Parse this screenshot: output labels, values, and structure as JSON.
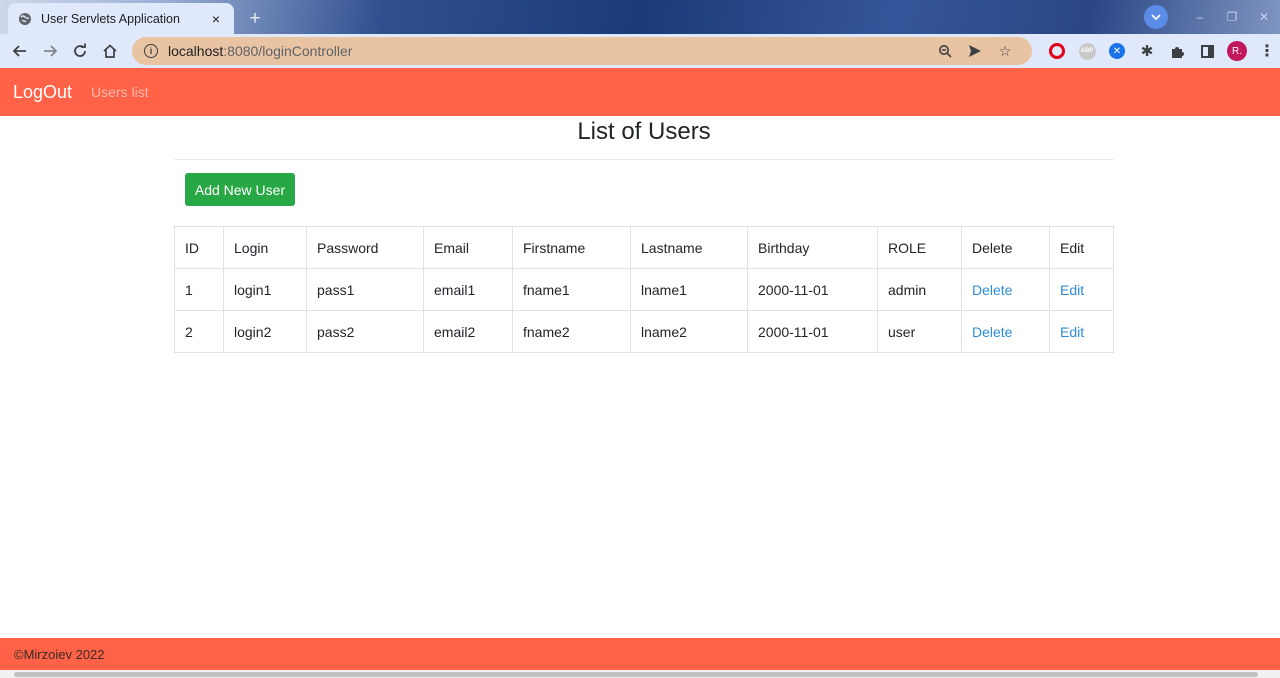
{
  "browser": {
    "tab_title": "User Servlets Application",
    "tab_close": "×",
    "new_tab": "+",
    "url_host": "localhost",
    "url_rest": ":8080/loginController",
    "avatar_initial": "R."
  },
  "navbar": {
    "brand": "LogOut",
    "link": "Users list"
  },
  "page": {
    "title": "List of Users",
    "add_button": "Add New User"
  },
  "table": {
    "headers": [
      "ID",
      "Login",
      "Password",
      "Email",
      "Firstname",
      "Lastname",
      "Birthday",
      "ROLE",
      "Delete",
      "Edit"
    ],
    "rows": [
      {
        "id": "1",
        "login": "login1",
        "password": "pass1",
        "email": "email1",
        "firstname": "fname1",
        "lastname": "lname1",
        "birthday": "2000-11-01",
        "role": "admin",
        "delete": "Delete",
        "edit": "Edit"
      },
      {
        "id": "2",
        "login": "login2",
        "password": "pass2",
        "email": "email2",
        "firstname": "fname2",
        "lastname": "lname2",
        "birthday": "2000-11-01",
        "role": "user",
        "delete": "Delete",
        "edit": "Edit"
      }
    ]
  },
  "footer": {
    "text": "©Mirzoiev 2022"
  },
  "colors": {
    "accent": "#ff6247",
    "button_green": "#28a745",
    "link_blue": "#2d8cd6"
  }
}
